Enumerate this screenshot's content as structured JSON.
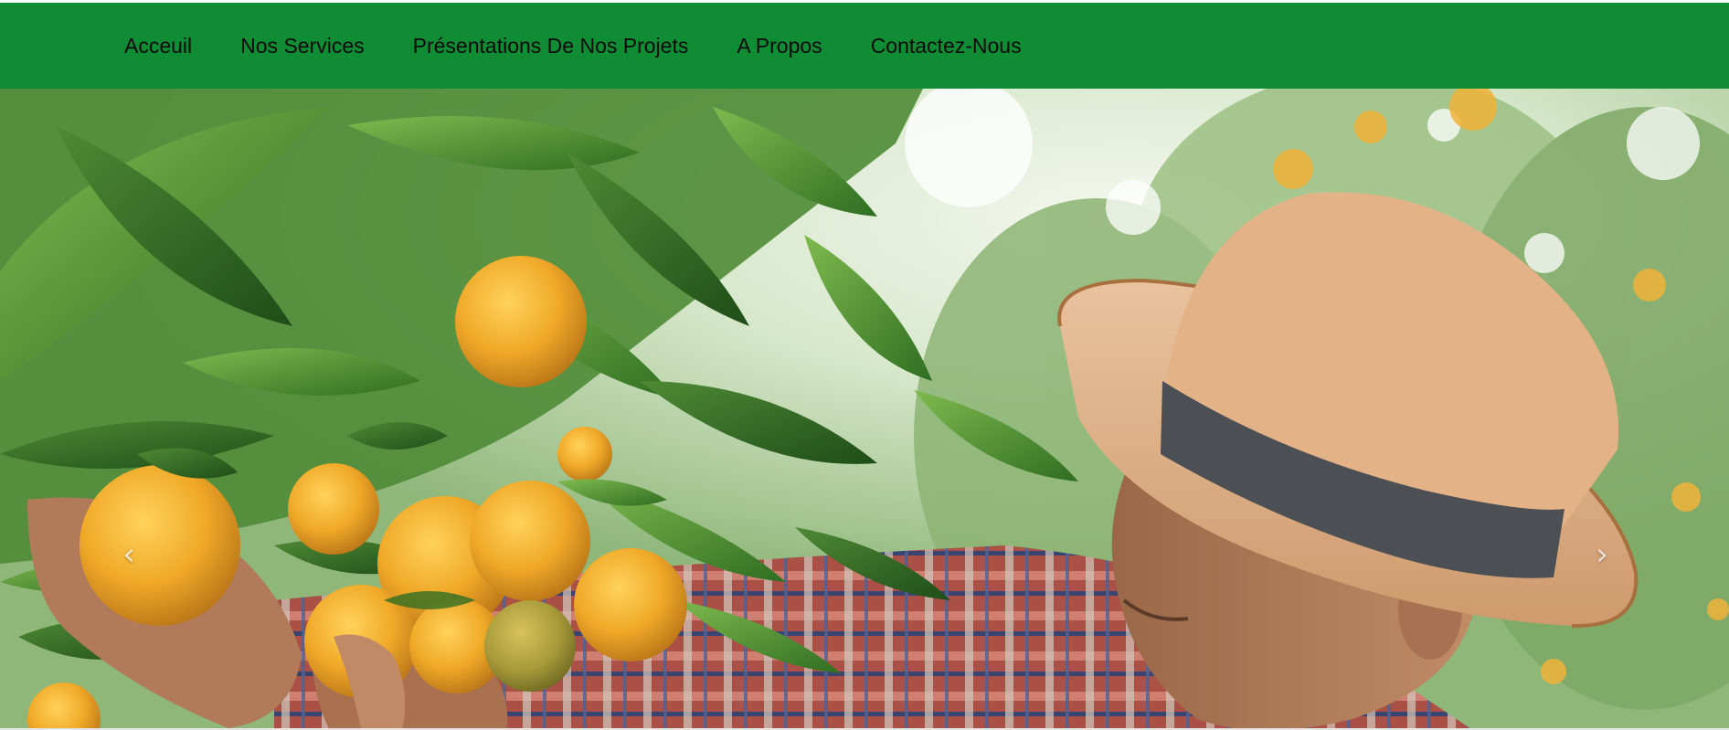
{
  "nav": {
    "items": [
      {
        "label": "Acceuil"
      },
      {
        "label": "Nos Services"
      },
      {
        "label": "Présentations De Nos Projets"
      },
      {
        "label": "A Propos"
      },
      {
        "label": "Contactez-Nous"
      }
    ],
    "background_color": "#0f8c34",
    "text_color": "#0a0a0a"
  },
  "hero": {
    "image": "farmer-inspecting-orange-tree",
    "prev_icon": "chevron-left-icon",
    "next_icon": "chevron-right-icon",
    "prev_glyph": "‹",
    "next_glyph": "›"
  }
}
